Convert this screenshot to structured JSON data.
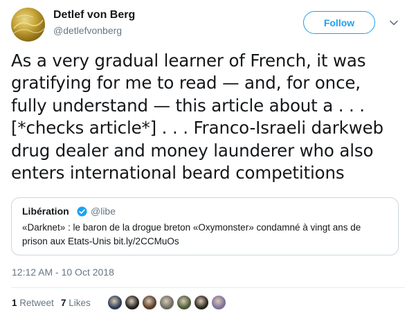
{
  "author": {
    "name": "Detlef von Berg",
    "handle": "@detlefvonberg",
    "avatar_icon": "gold-foil-avatar"
  },
  "follow_label": "Follow",
  "tweet_lines": [
    "As a very gradual learner of French, it was",
    "gratifying for me to read — and, for once,",
    "fully understand — this article about a . . .",
    "[*checks article*] . . . Franco-Israeli darkweb",
    "drug dealer and money launderer who also",
    "enters international beard competitions"
  ],
  "quoted": {
    "name": "Libération",
    "handle": "@libe",
    "verified_icon": "verified-badge-icon",
    "lines": [
      "«Darknet» : le baron de la drogue breton «Oxymonster» condamné à vingt ans de",
      "prison aux Etats-Unis bit.ly/2CCMuOs"
    ]
  },
  "timestamp": "12:12 AM - 10 Oct 2018",
  "stats": {
    "retweet_count": "1",
    "retweet_label": "Retweet",
    "like_count": "7",
    "like_label": "Likes"
  },
  "likers": [
    {
      "name": "liker-1",
      "color": "#2b3a55"
    },
    {
      "name": "liker-2",
      "color": "#1f1f1f"
    },
    {
      "name": "liker-3",
      "color": "#5a3b2a"
    },
    {
      "name": "liker-4",
      "color": "#6d6a63"
    },
    {
      "name": "liker-5",
      "color": "#4a5a3a"
    },
    {
      "name": "liker-6",
      "color": "#2a2420"
    },
    {
      "name": "liker-7",
      "color": "#7d6f9a"
    }
  ],
  "colors": {
    "accent": "#1da1f2",
    "text": "#14171a",
    "muted": "#657786",
    "border": "#ccd6dd"
  }
}
